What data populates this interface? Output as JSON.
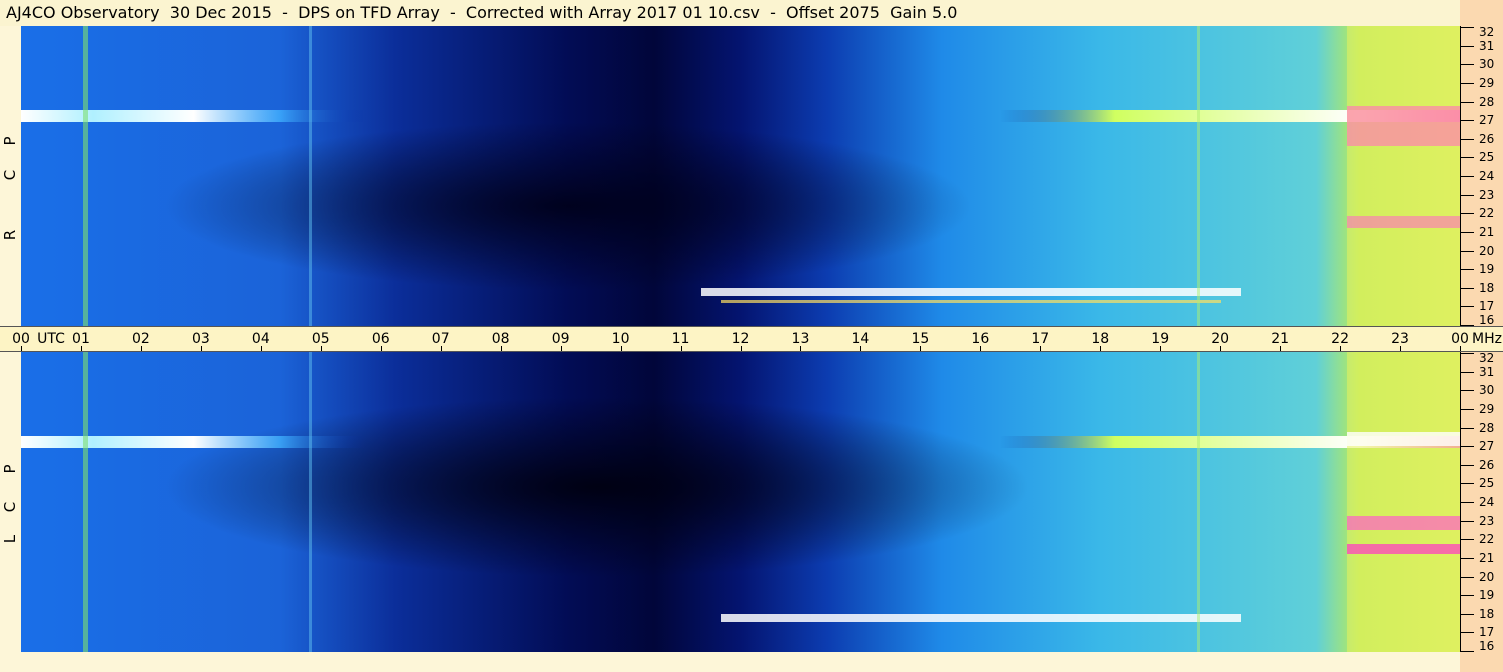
{
  "title": "AJ4CO Observatory  30 Dec 2015  -  DPS on TFD Array  -  Corrected with Array 2017 01 10.csv  -  Offset 2075  Gain 5.0",
  "time_axis": {
    "labels": [
      "00",
      "01",
      "02",
      "03",
      "04",
      "05",
      "06",
      "07",
      "08",
      "09",
      "10",
      "11",
      "12",
      "13",
      "14",
      "15",
      "16",
      "17",
      "18",
      "19",
      "20",
      "21",
      "22",
      "23",
      "00"
    ],
    "utc_label": "UTC",
    "unit_label": "MHz"
  },
  "panels": [
    {
      "polarization": [
        "R",
        "C",
        "P"
      ],
      "freq_labels": [
        "32",
        "31",
        "30",
        "29",
        "28",
        "27",
        "26",
        "25",
        "24",
        "23",
        "22",
        "21",
        "20",
        "19",
        "18",
        "17",
        "16"
      ]
    },
    {
      "polarization": [
        "L",
        "C",
        "P"
      ],
      "freq_labels": [
        "32",
        "31",
        "30",
        "29",
        "28",
        "27",
        "26",
        "25",
        "24",
        "23",
        "22",
        "21",
        "20",
        "19",
        "18",
        "17",
        "16"
      ]
    }
  ],
  "colors": {
    "background": "#fdf6d8",
    "spectrum_low": "#000a4a",
    "spectrum_mid": "#1e6fe0",
    "spectrum_high": "#9ff05a",
    "spectrum_peak": "#ff30c0",
    "right_strip": "#fbd9b0"
  }
}
